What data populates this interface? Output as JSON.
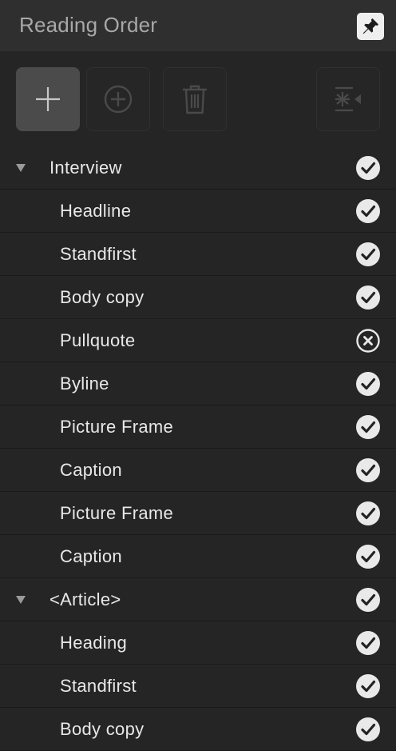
{
  "panel": {
    "title": "Reading Order",
    "pin_icon": "pin-icon"
  },
  "toolbar": {
    "buttons": [
      {
        "name": "add-button",
        "icon": "plus-icon",
        "active": true
      },
      {
        "name": "add-circle-button",
        "icon": "plus-circle-icon",
        "active": false
      },
      {
        "name": "delete-button",
        "icon": "trash-icon",
        "active": false
      },
      {
        "name": "reading-order-settings-button",
        "icon": "list-sort-icon",
        "active": false
      }
    ]
  },
  "tree": {
    "rows": [
      {
        "label": "Interview",
        "level": 0,
        "status": "checked"
      },
      {
        "label": "Headline",
        "level": 1,
        "status": "checked"
      },
      {
        "label": "Standfirst",
        "level": 1,
        "status": "checked"
      },
      {
        "label": "Body copy",
        "level": 1,
        "status": "checked"
      },
      {
        "label": "Pullquote",
        "level": 1,
        "status": "excluded"
      },
      {
        "label": "Byline",
        "level": 1,
        "status": "checked"
      },
      {
        "label": "Picture Frame",
        "level": 1,
        "status": "checked"
      },
      {
        "label": "Caption",
        "level": 1,
        "status": "checked"
      },
      {
        "label": "Picture Frame",
        "level": 1,
        "status": "checked"
      },
      {
        "label": "Caption",
        "level": 1,
        "status": "checked"
      },
      {
        "label": "<Article>",
        "level": 0,
        "status": "checked"
      },
      {
        "label": "Heading",
        "level": 1,
        "status": "checked"
      },
      {
        "label": "Standfirst",
        "level": 1,
        "status": "checked"
      },
      {
        "label": "Body copy",
        "level": 1,
        "status": "checked"
      }
    ]
  }
}
